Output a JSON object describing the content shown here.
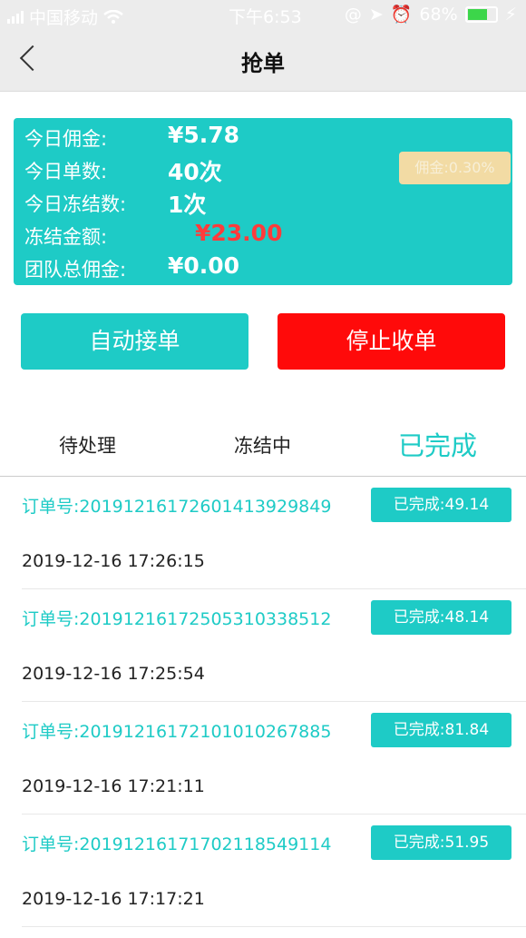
{
  "status_bar": {
    "carrier": "中国移动",
    "time": "下午6:53",
    "battery": "68%",
    "battery_level": 0.68
  },
  "nav": {
    "title": "抢单",
    "back_icon": "chevron-left-icon"
  },
  "stats": {
    "today_commission_label": "今日佣金:",
    "today_commission_value": "¥5.78",
    "today_orders_label": "今日单数:",
    "today_orders_value": "40次",
    "today_frozen_label": "今日冻结数:",
    "today_frozen_value": "1次",
    "frozen_amount_label": "冻结金额:",
    "frozen_amount_value": "¥23.00",
    "team_commission_label": "团队总佣金:",
    "team_commission_value": "¥0.00",
    "commission_rate_badge": "佣金:0.30%",
    "colors": {
      "card": "#1ecbc6",
      "frozen_amount": "#ff3b3b",
      "badge": "#f2dba4"
    }
  },
  "actions": {
    "auto_accept": "自动接单",
    "stop_accept": "停止收单"
  },
  "tabs": [
    {
      "label": "待处理",
      "active": false
    },
    {
      "label": "冻结中",
      "active": false
    },
    {
      "label": "已完成",
      "active": true
    }
  ],
  "orders": [
    {
      "id": "订单号:20191216172601413929849",
      "status": "已完成:49.14",
      "time": "2019-12-16 17:26:15"
    },
    {
      "id": "订单号:20191216172505310338512",
      "status": "已完成:48.14",
      "time": "2019-12-16 17:25:54"
    },
    {
      "id": "订单号:20191216172101010267885",
      "status": "已完成:81.84",
      "time": "2019-12-16 17:21:11"
    },
    {
      "id": "订单号:20191216171702118549114",
      "status": "已完成:51.95",
      "time": "2019-12-16 17:17:21"
    }
  ]
}
